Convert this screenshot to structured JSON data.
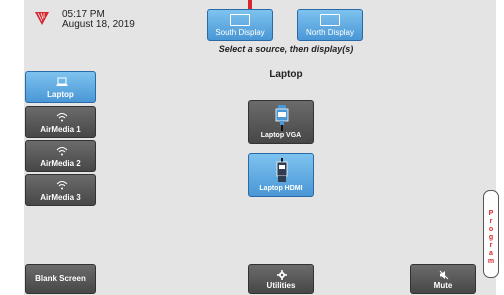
{
  "status": {
    "time": "05:17 PM",
    "date": "August 18, 2019"
  },
  "displays": [
    {
      "label": "South Display",
      "icon": "monitor-icon"
    },
    {
      "label": "North Display",
      "icon": "monitor-icon"
    }
  ],
  "instruction": "Select a source, then display(s)",
  "selected_source_title": "Laptop",
  "sidebar": {
    "items": [
      {
        "label": "Laptop",
        "icon": "laptop-icon",
        "selected": true
      },
      {
        "label": "AirMedia 1",
        "icon": "wifi-icon",
        "selected": false
      },
      {
        "label": "AirMedia 2",
        "icon": "wifi-icon",
        "selected": false
      },
      {
        "label": "AirMedia 3",
        "icon": "wifi-icon",
        "selected": false
      }
    ]
  },
  "inputs": [
    {
      "label": "Laptop VGA",
      "icon": "vga-cable-icon",
      "selected": false
    },
    {
      "label": "Laptop HDMI",
      "icon": "hdmi-cable-icon",
      "selected": true
    }
  ],
  "bottom": {
    "blank_screen": "Blank Screen",
    "utilities": "Utilities",
    "mute": "Mute"
  },
  "program_tab": {
    "label": "Program"
  },
  "colors": {
    "accent_red": "#d8262e",
    "selected_blue": "#4a97d6",
    "button_grey": "#555555",
    "background": "#e4e4e4"
  }
}
